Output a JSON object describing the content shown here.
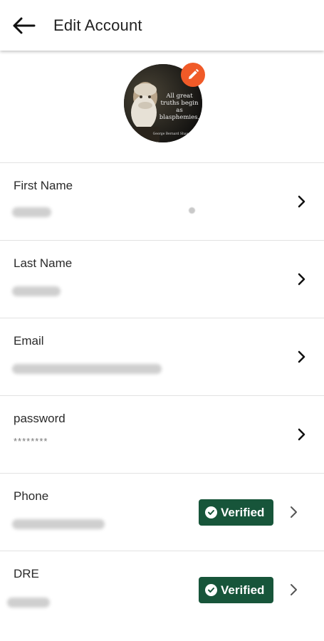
{
  "header": {
    "title": "Edit Account",
    "back_icon": "arrow-left-icon"
  },
  "avatar": {
    "quote": "All great truths begin as blasphemies.",
    "author": "George Bernard Shaw",
    "edit_icon": "pencil-icon",
    "badge_color": "#f05a28"
  },
  "fields": [
    {
      "label": "First Name",
      "value": "",
      "verified": false
    },
    {
      "label": "Last Name",
      "value": "",
      "verified": false
    },
    {
      "label": "Email",
      "value": "",
      "verified": false
    },
    {
      "label": "password",
      "value": "********",
      "verified": false
    },
    {
      "label": "Phone",
      "value": "",
      "verified": true
    },
    {
      "label": "DRE",
      "value": "",
      "verified": true
    }
  ],
  "verified_label": "Verified",
  "colors": {
    "verified_bg": "#17553a",
    "accent": "#f05a28"
  }
}
